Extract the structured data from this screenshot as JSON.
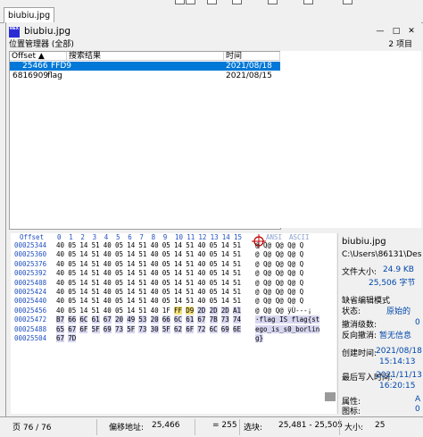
{
  "toolbar": {
    "icons": [
      "save-icon",
      "print-icon",
      "copy-icon",
      "paste-icon",
      "find-icon",
      "tools-icon",
      "help-icon"
    ]
  },
  "tab": {
    "label": "biubiu.jpg"
  },
  "window": {
    "title": "biubiu.jpg",
    "icon_text": "HEX",
    "buttons": [
      "—",
      "□",
      "✕"
    ]
  },
  "position_manager": {
    "label": "位置管理器 (全部)",
    "count": "2 项目"
  },
  "list": {
    "headers": [
      "Offset ▲",
      "搜索结果",
      "时间"
    ],
    "rows": [
      {
        "offset": "25466",
        "result": "FFD9",
        "time": "2021/08/18",
        "selected": true
      },
      {
        "offset": "6816909",
        "result": "flag",
        "time": "2021/08/15",
        "selected": false
      }
    ]
  },
  "hex": {
    "headers": [
      "Offset",
      "0",
      "1",
      "2",
      "3",
      "4",
      "5",
      "6",
      "7",
      "8",
      "9",
      "10",
      "11",
      "12",
      "13",
      "14",
      "15"
    ],
    "ansi_label": "ANSI",
    "ascii_label": "ASCII",
    "rows": [
      {
        "off": "00025344",
        "bytes": [
          "40",
          "05",
          "14",
          "51",
          "40",
          "05",
          "14",
          "51",
          "40",
          "05",
          "14",
          "51",
          "40",
          "05",
          "14",
          "51"
        ],
        "text": "@  Q@  Q@  Q@  Q"
      },
      {
        "off": "00025360",
        "bytes": [
          "40",
          "05",
          "14",
          "51",
          "40",
          "05",
          "14",
          "51",
          "40",
          "05",
          "14",
          "51",
          "40",
          "05",
          "14",
          "51"
        ],
        "text": "@  Q@  Q@  Q@  Q"
      },
      {
        "off": "00025376",
        "bytes": [
          "40",
          "05",
          "14",
          "51",
          "40",
          "05",
          "14",
          "51",
          "40",
          "05",
          "14",
          "51",
          "40",
          "05",
          "14",
          "51"
        ],
        "text": "@  Q@  Q@  Q@  Q"
      },
      {
        "off": "00025392",
        "bytes": [
          "40",
          "05",
          "14",
          "51",
          "40",
          "05",
          "14",
          "51",
          "40",
          "05",
          "14",
          "51",
          "40",
          "05",
          "14",
          "51"
        ],
        "text": "@  Q@  Q@  Q@  Q"
      },
      {
        "off": "00025408",
        "bytes": [
          "40",
          "05",
          "14",
          "51",
          "40",
          "05",
          "14",
          "51",
          "40",
          "05",
          "14",
          "51",
          "40",
          "05",
          "14",
          "51"
        ],
        "text": "@  Q@  Q@  Q@  Q"
      },
      {
        "off": "00025424",
        "bytes": [
          "40",
          "05",
          "14",
          "51",
          "40",
          "05",
          "14",
          "51",
          "40",
          "05",
          "14",
          "51",
          "40",
          "05",
          "14",
          "51"
        ],
        "text": "@  Q@  Q@  Q@  Q"
      },
      {
        "off": "00025440",
        "bytes": [
          "40",
          "05",
          "14",
          "51",
          "40",
          "05",
          "14",
          "51",
          "40",
          "05",
          "14",
          "51",
          "40",
          "05",
          "14",
          "51"
        ],
        "text": "@  Q@  Q@  Q@  Q"
      },
      {
        "off": "00025456",
        "bytes": [
          "40",
          "05",
          "14",
          "51",
          "40",
          "05",
          "14",
          "51",
          "40",
          "1F",
          "FF",
          "D9",
          "2D",
          "2D",
          "2D",
          "A1"
        ],
        "text": "@  Q@  Q@ ÿÙ---¡"
      },
      {
        "off": "00025472",
        "bytes": [
          "B7",
          "66",
          "6C",
          "61",
          "67",
          "20",
          "49",
          "53",
          "20",
          "66",
          "6C",
          "61",
          "67",
          "7B",
          "73",
          "74"
        ],
        "text": "·flag IS flag{st"
      },
      {
        "off": "00025488",
        "bytes": [
          "65",
          "67",
          "6F",
          "5F",
          "69",
          "73",
          "5F",
          "73",
          "30",
          "5F",
          "62",
          "6F",
          "72",
          "6C",
          "69",
          "6E"
        ],
        "text": "ego_is_s0_borlin"
      },
      {
        "off": "00025504",
        "bytes": [
          "67",
          "7D"
        ],
        "text": "g}"
      }
    ]
  },
  "side": {
    "filename": "biubiu.jpg",
    "path": "C:\\Users\\86131\\Des",
    "file_size_label": "文件大小:",
    "file_size_kb": "24.9 KB",
    "file_size_bytes": "25,506 字节",
    "edit_mode_label": "缺省编辑模式",
    "state_label": "状态:",
    "state_value": "原始的",
    "undo_level_label": "撤消级数:",
    "undo_level_value": "0",
    "reverse_undo_label": "反向撤消:",
    "reverse_undo_value": "暂无信息",
    "created_label": "创建时间:",
    "created_date": "2021/08/18",
    "created_time": "15:14:13",
    "modified_label": "最后写入时间:",
    "modified_date": "2021/11/13",
    "modified_time": "16:20:15",
    "attr_label": "属性:",
    "attr_value": "A",
    "icon_label": "图标:",
    "icon_value": "0"
  },
  "status": {
    "page": "页 76 / 76",
    "offset_label": "偏移地址:",
    "offset_value": "25,466",
    "eq_value": "= 255",
    "block_label": "选块:",
    "block_value": "25,481 - 25,505",
    "size_label": "大小:",
    "size_value": "25"
  }
}
